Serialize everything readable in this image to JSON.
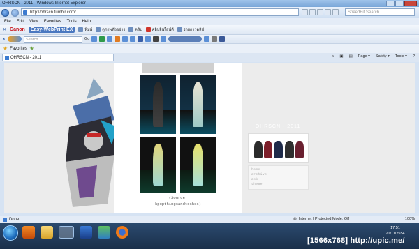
{
  "window": {
    "title": "OHRSCN - 2011 - Windows Internet Explorer"
  },
  "address": {
    "url": "http://ohrscn.tumblr.com/",
    "search_placeholder": "SpeedBit Search"
  },
  "menu": [
    "File",
    "Edit",
    "View",
    "Favorites",
    "Tools",
    "Help"
  ],
  "toolbar1": {
    "brand": "Canon",
    "product": "Easy-WebPrint EX",
    "buttons": [
      "พิมพ์",
      "ดูภาพตัวอย่าง",
      "คลิป",
      "คลิปอินไลน์ดี",
      "รายการคลิป"
    ]
  },
  "toolbar2": {
    "search_placeholder": "Search",
    "go_label": "Go"
  },
  "favbar": {
    "favorites_label": "Favorites"
  },
  "tab": {
    "label": "OHRSCN - 2011"
  },
  "commandbar": [
    "Page ▾",
    "Safety ▾",
    "Tools ▾",
    "?"
  ],
  "page": {
    "caption_source": "(Source:",
    "caption_credit": "kpopthingsandtoshes)",
    "sidebar_title": "OHRSCN - 2011",
    "sidebar_links": [
      "home",
      "archive",
      "ask",
      "theme"
    ]
  },
  "status": {
    "left": "Done",
    "zone": "Internet | Protected Mode: Off",
    "zoom": "100%"
  },
  "tray": {
    "time": "17:51",
    "date": "21/11/2554"
  },
  "watermark": "[1566x768] http://upic.me/"
}
